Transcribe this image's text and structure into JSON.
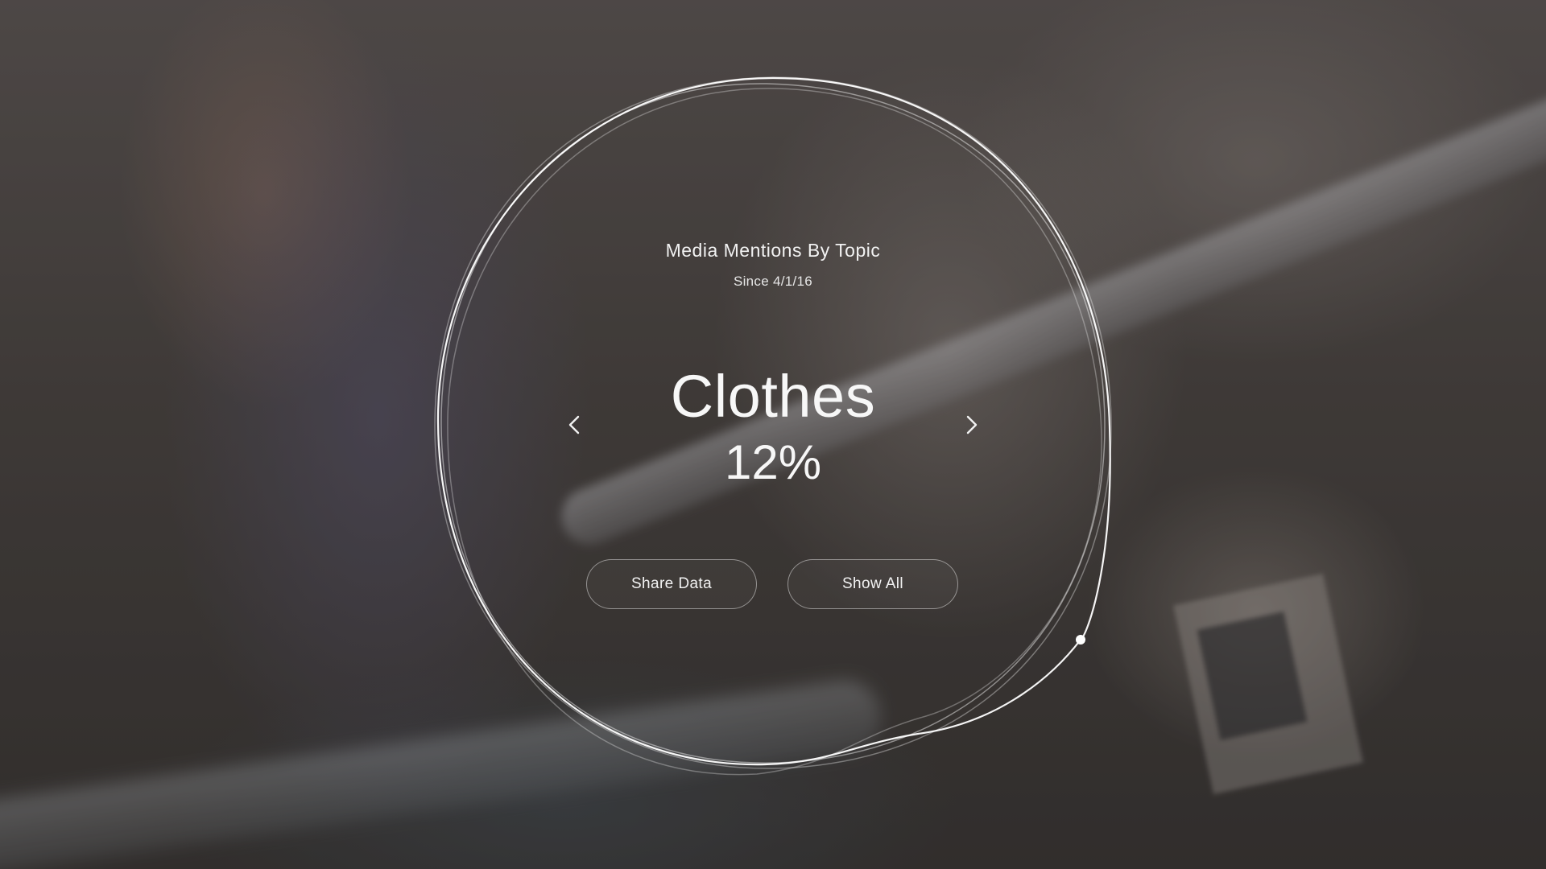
{
  "panel": {
    "title": "Media Mentions By Topic",
    "subtitle": "Since 4/1/16",
    "topic": "Clothes",
    "value": "12%"
  },
  "nav": {
    "prev_icon": "chevron-left-icon",
    "next_icon": "chevron-right-icon"
  },
  "actions": {
    "share_label": "Share Data",
    "show_all_label": "Show All"
  },
  "colors": {
    "text": "#f2f2f2",
    "ring": "#ffffff"
  }
}
